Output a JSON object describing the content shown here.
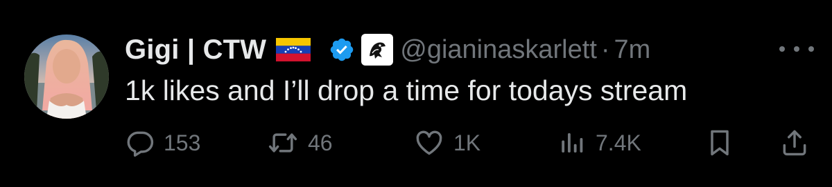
{
  "tweet": {
    "author": {
      "name": "Gigi | CTW",
      "handle": "@gianinaskarlett",
      "separator": "·",
      "time": "7m",
      "avatar_icon": "profile-photo",
      "flag_icon": "venezuela-flag-icon",
      "verified_icon": "blue-verified-badge-icon",
      "affiliation_icon": "affiliate-logo-icon"
    },
    "text": "1k likes and I’ll drop a time for todays stream",
    "actions": {
      "reply_count": "153",
      "retweet_count": "46",
      "like_count": "1K",
      "view_count": "7.4K"
    },
    "colors": {
      "background": "#000000",
      "primary_text": "#e7e9ea",
      "secondary_text": "#71767b",
      "verified_blue": "#1d9bf0"
    }
  }
}
